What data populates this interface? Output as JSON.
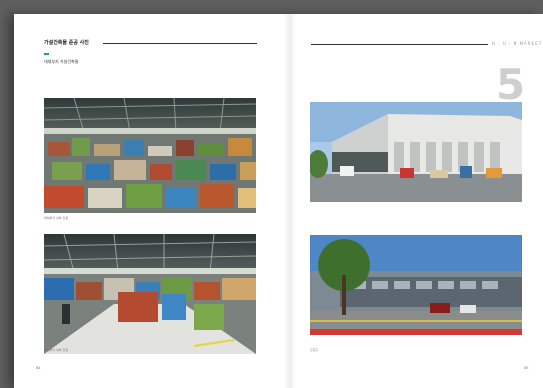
{
  "left_page": {
    "section_title": "가설건축물 준공 사진",
    "section_subtitle": "대체부지 가설건축물",
    "photo_captions": [
      "대체부지 내부 전경",
      "대체부지 내부 전경"
    ],
    "page_number": "84"
  },
  "right_page": {
    "brand": "H · U · B MARKET",
    "chapter_number": "5",
    "photo_captions": [
      "",
      "출입구"
    ],
    "page_number": "85"
  },
  "colors": {
    "accent": "#1aa58a",
    "page": "#ffffff",
    "background": "#5f5f5f"
  }
}
